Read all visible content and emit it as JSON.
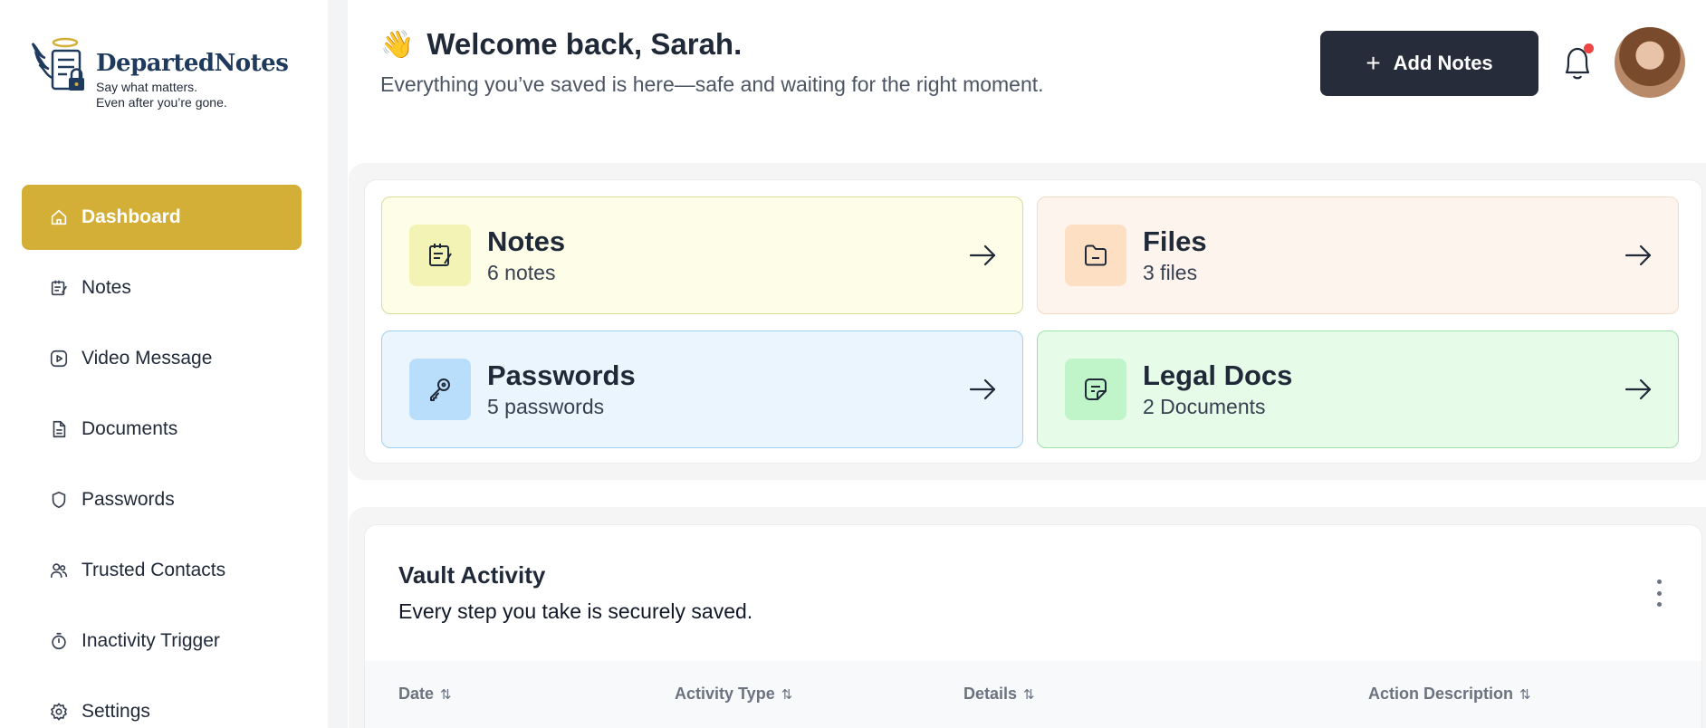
{
  "brand": {
    "name": "DepartedNotes",
    "tagline_line1": "Say what matters.",
    "tagline_line2": "Even after you’re gone."
  },
  "sidebar": {
    "items": [
      {
        "label": "Dashboard",
        "icon": "home-icon",
        "active": true
      },
      {
        "label": "Notes",
        "icon": "notepad-icon"
      },
      {
        "label": "Video Message",
        "icon": "video-icon"
      },
      {
        "label": "Documents",
        "icon": "document-icon"
      },
      {
        "label": "Passwords",
        "icon": "shield-icon"
      },
      {
        "label": "Trusted Contacts",
        "icon": "users-icon"
      },
      {
        "label": "Inactivity Trigger",
        "icon": "timer-icon"
      },
      {
        "label": "Settings",
        "icon": "gear-icon"
      }
    ]
  },
  "header": {
    "wave_emoji": "👋",
    "title": "Welcome back, Sarah.",
    "subtitle": "Everything you’ve saved is here—safe and waiting for the right moment.",
    "add_button_label": "Add Notes",
    "has_notification": true
  },
  "cards": [
    {
      "title": "Notes",
      "count": "6 notes",
      "icon": "notepad-icon"
    },
    {
      "title": "Files",
      "count": "3 files",
      "icon": "folder-icon"
    },
    {
      "title": "Passwords",
      "count": "5 passwords",
      "icon": "key-icon"
    },
    {
      "title": "Legal Docs",
      "count": "2 Documents",
      "icon": "sticky-note-icon"
    }
  ],
  "activity": {
    "title": "Vault Activity",
    "subtitle": "Every step you take is securely saved.",
    "columns": [
      "Date",
      "Activity Type",
      "Details",
      "Action Description"
    ]
  },
  "colors": {
    "accent": "#d4af37",
    "dark_button": "#262c3a",
    "brand_navy": "#1f3a5c",
    "notification": "#ef4444"
  }
}
